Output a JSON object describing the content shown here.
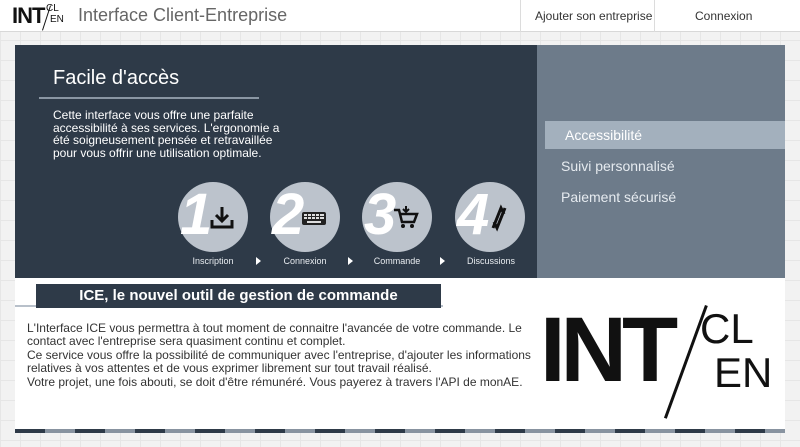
{
  "header": {
    "logo": {
      "int": "INT",
      "cl": "CL",
      "en": "EN"
    },
    "title": "Interface Client-Entreprise",
    "nav": [
      {
        "label": "Ajouter son entreprise"
      },
      {
        "label": "Connexion"
      }
    ]
  },
  "hero": {
    "title": "Facile d'accès",
    "text": "Cette interface vous offre une parfaite accessibilité à ses services. L'ergonomie a été soigneusement pensée et retravaillée pour vous offrir une utilisation optimale.",
    "steps": [
      {
        "number": "1",
        "label": "Inscription",
        "icon": "download-icon"
      },
      {
        "number": "2",
        "label": "Connexion",
        "icon": "keyboard-icon"
      },
      {
        "number": "3",
        "label": "Commande",
        "icon": "cart-icon"
      },
      {
        "number": "4",
        "label": "Discussions",
        "icon": "exchange-icon"
      }
    ]
  },
  "side_menu": {
    "items": [
      {
        "label": "Accessibilité",
        "active": true
      },
      {
        "label": "Suivi personnalisé",
        "active": false
      },
      {
        "label": "Paiement sécurisé",
        "active": false
      }
    ]
  },
  "content": {
    "banner": "ICE, le nouvel outil de gestion de commande",
    "paragraphs": [
      "L'Interface ICE vous permettra à tout moment de connaitre l'avancée de votre commande. Le contact avec l'entreprise sera quasiment continu et complet.",
      "Ce service vous offre la possibilité de communiquer avec l'entreprise, d'ajouter les informations relatives à vos attentes et de vous exprimer librement sur tout travail réalisé.",
      "Votre projet, une fois abouti, se doit d'être rémunéré. Vous payerez à travers l'API de monAE."
    ],
    "logo": {
      "int": "INT",
      "cl": "CL",
      "en": "EN"
    }
  },
  "colors": {
    "hero_bg": "#2e3a48",
    "side_bg": "#6d7b8a",
    "side_active": "#a3b0bd",
    "step_circle": "#bcc3cc"
  }
}
